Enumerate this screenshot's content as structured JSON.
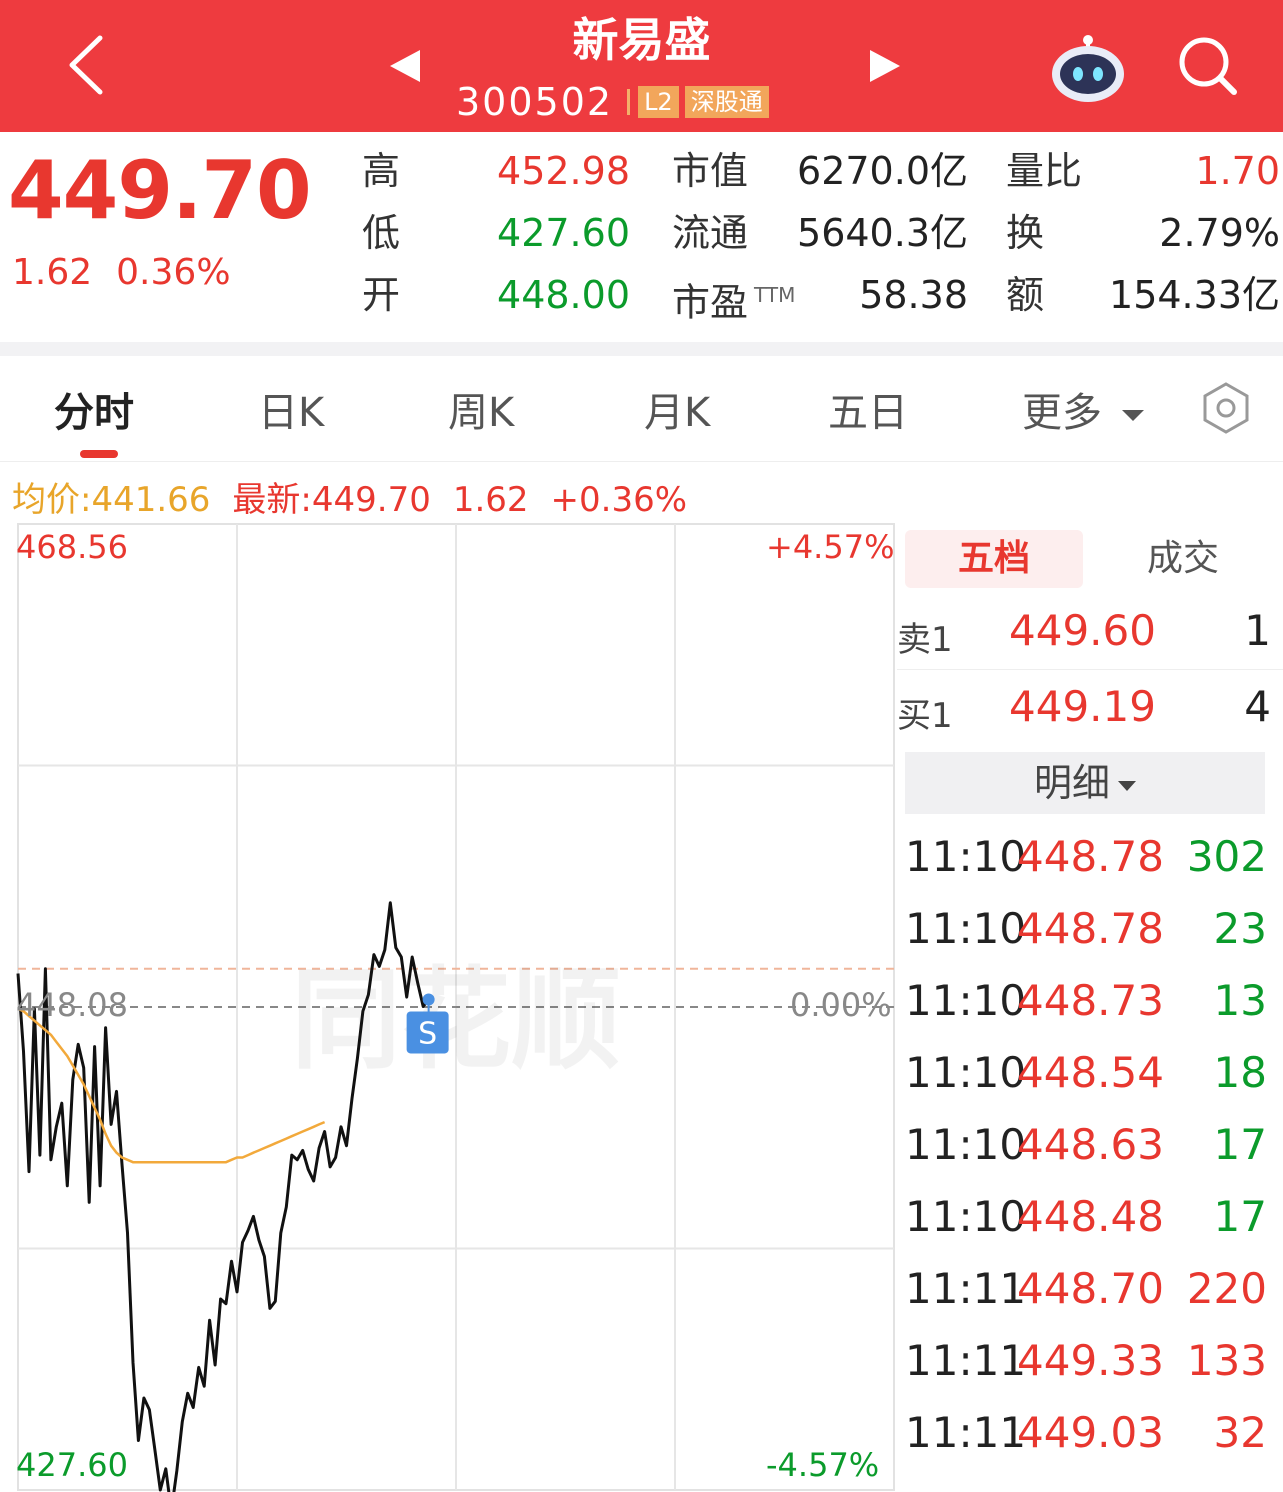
{
  "header": {
    "stock_name": "新易盛",
    "stock_code": "300502",
    "badge_l2": "L2",
    "badge_connect": "深股通",
    "icons": [
      "back-icon",
      "prev-stock-icon",
      "next-stock-icon",
      "robot-assistant-icon",
      "search-icon"
    ],
    "bg_color": "#ee3b3f"
  },
  "quote": {
    "price": "449.70",
    "change": "1.62",
    "change_pct": "0.36%",
    "high_label": "高",
    "high": "452.98",
    "low_label": "低",
    "low": "427.60",
    "open_label": "开",
    "open": "448.00",
    "mcap_label": "市值",
    "mcap": "6270.0亿",
    "float_label": "流通",
    "float": "5640.3亿",
    "pe_label": "市盈",
    "pe_suffix": "TTM",
    "pe": "58.38",
    "vol_ratio_label": "量比",
    "vol_ratio": "1.70",
    "turnover_label": "换",
    "turnover": "2.79%",
    "amount_label": "额",
    "amount": "154.33亿"
  },
  "tabs": [
    "分时",
    "日K",
    "周K",
    "月K",
    "五日",
    "更多"
  ],
  "active_tab": "分时",
  "infoline": {
    "avg": "均价:441.66",
    "latest": "最新:449.70",
    "change": "1.62",
    "change_pct": "+0.36%"
  },
  "chart_data": {
    "type": "line",
    "y_max_label": "468.56",
    "y_min_label": "427.60",
    "y_mid_label": "448.08",
    "pct_max_label": "+4.57%",
    "pct_min_label": "-4.57%",
    "pct_mid_label": "0.00%",
    "ylim": [
      427.6,
      468.56
    ],
    "prev_close": 448.08,
    "marker": "S",
    "watermark": "同花顺",
    "series": [
      {
        "values": [
          449.5,
          446.2,
          441.1,
          448.0,
          441.8,
          449.7,
          441.6,
          443.0,
          444.0,
          440.5,
          445.0,
          446.5,
          445.5,
          439.8,
          446.4,
          440.5,
          447.2,
          443.1,
          444.5,
          441.4,
          438.5,
          433.0,
          429.7,
          431.5,
          431.0,
          429.3,
          427.6,
          428.5,
          426.7,
          428.4,
          430.5,
          431.7,
          431.1,
          432.8,
          432.0,
          434.8,
          432.9,
          435.7,
          435.5,
          437.3,
          436.0,
          438.1,
          438.6,
          439.2,
          438.2,
          437.5,
          435.3,
          435.6,
          438.5,
          439.6,
          441.8,
          441.6,
          442.0,
          441.2,
          440.7,
          442.1,
          442.8,
          441.3,
          441.7,
          443.0,
          442.2,
          444.2,
          445.9,
          447.9,
          448.6,
          450.3,
          449.8,
          450.5,
          452.5,
          450.6,
          450.2,
          448.5,
          450.2,
          449.1,
          448.1,
          448.4
        ]
      },
      {
        "values": [
          448.0,
          447.9,
          447.7,
          447.5,
          447.3,
          447.1,
          446.9,
          446.6,
          446.3,
          446.0,
          445.6,
          445.2,
          444.8,
          444.3,
          443.8,
          443.3,
          442.7,
          442.2,
          441.9,
          441.7,
          441.6,
          441.5,
          441.5,
          441.5,
          441.5,
          441.5,
          441.5,
          441.5,
          441.5,
          441.5,
          441.5,
          441.5,
          441.5,
          441.5,
          441.5,
          441.5,
          441.5,
          441.5,
          441.5,
          441.6,
          441.7,
          441.7,
          441.8,
          441.9,
          442.0,
          442.1,
          442.2,
          442.3,
          442.4,
          442.5,
          442.6,
          442.7,
          442.8,
          442.9,
          443.0,
          443.1,
          443.2
        ]
      }
    ]
  },
  "order_book": {
    "tab_active": "五档",
    "tab_other": "成交",
    "ask1_label": "卖1",
    "ask1_price": "449.60",
    "ask1_vol": "1",
    "bid1_label": "买1",
    "bid1_price": "449.19",
    "bid1_vol": "4",
    "detail_label": "明细",
    "trades": [
      {
        "time": "11:10",
        "price": "448.78",
        "vol": "302",
        "color": "green"
      },
      {
        "time": "11:10",
        "price": "448.78",
        "vol": "23",
        "color": "green"
      },
      {
        "time": "11:10",
        "price": "448.73",
        "vol": "13",
        "color": "green"
      },
      {
        "time": "11:10",
        "price": "448.54",
        "vol": "18",
        "color": "green"
      },
      {
        "time": "11:10",
        "price": "448.63",
        "vol": "17",
        "color": "green"
      },
      {
        "time": "11:10",
        "price": "448.48",
        "vol": "17",
        "color": "green"
      },
      {
        "time": "11:11",
        "price": "448.70",
        "vol": "220",
        "color": "red"
      },
      {
        "time": "11:11",
        "price": "449.33",
        "vol": "133",
        "color": "red"
      },
      {
        "time": "11:11",
        "price": "449.03",
        "vol": "32",
        "color": "red"
      }
    ]
  }
}
